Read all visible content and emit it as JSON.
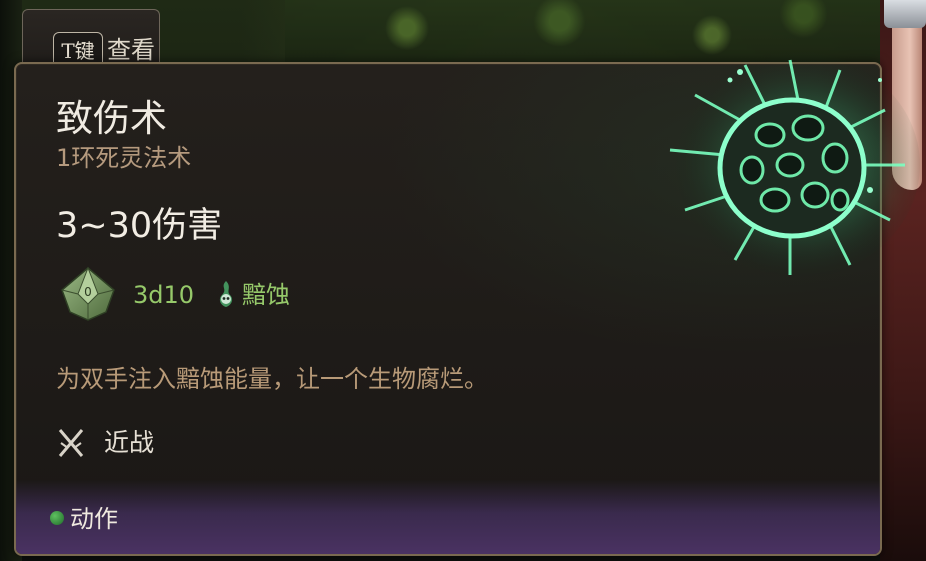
{
  "hotkey": {
    "key": "T键",
    "label": "查看"
  },
  "spell": {
    "name": "致伤术",
    "level_school": "1环死灵法术",
    "damage": "3~30伤害",
    "dice": "3d10",
    "damage_type": "黯蚀",
    "description": "为双手注入黯蚀能量，让一个生物腐烂。",
    "range": "近战",
    "cost": "动作"
  },
  "icons": {
    "die": "d10-die-icon",
    "damage_type": "necrotic-skull-icon",
    "range": "crossed-swords-icon",
    "cost": "action-dot-icon",
    "spell": "inflict-wounds-spell-icon"
  },
  "colors": {
    "dice_text": "#96c96a",
    "subtitle": "#b59a7e",
    "description": "#b89a78",
    "action_dot": "#3fa047",
    "spell_glow": "#5fe39a",
    "panel_border": "#7a6a50",
    "footer": "#4a3262"
  }
}
